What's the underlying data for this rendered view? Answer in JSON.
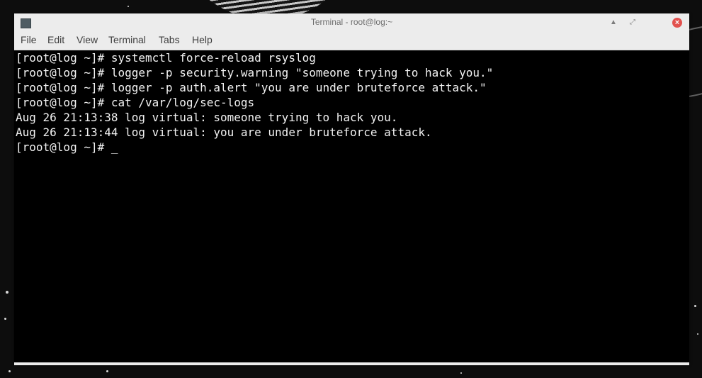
{
  "window": {
    "title": "Terminal - root@log:~",
    "controls": {
      "minimize_icon": "minimize-icon",
      "maximize_icon": "maximize-icon",
      "close_icon": "close-icon"
    }
  },
  "menu": [
    "File",
    "Edit",
    "View",
    "Terminal",
    "Tabs",
    "Help"
  ],
  "terminal": {
    "lines": [
      "[root@log ~]# systemctl force-reload rsyslog",
      "[root@log ~]# logger -p security.warning \"someone trying to hack you.\"",
      "[root@log ~]# logger -p auth.alert \"you are under bruteforce attack.\"",
      "[root@log ~]# cat /var/log/sec-logs",
      "Aug 26 21:13:38 log virtual: someone trying to hack you.",
      "Aug 26 21:13:44 log virtual: you are under bruteforce attack.",
      "[root@log ~]# "
    ],
    "cursor": "_"
  },
  "colors": {
    "titlebar": "#ececec",
    "terminal_bg": "#000000",
    "terminal_fg": "#f2f2f2",
    "close_button": "#e2514e"
  }
}
